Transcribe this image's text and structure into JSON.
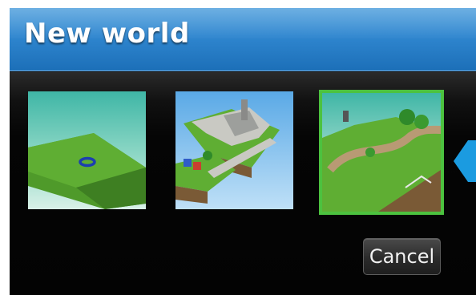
{
  "window": {
    "title": "New world"
  },
  "templates": [
    {
      "name": "flat-plain-world-thumbnail",
      "selected": false
    },
    {
      "name": "island-town-world-thumbnail",
      "selected": false
    },
    {
      "name": "hilly-path-world-thumbnail",
      "selected": true
    }
  ],
  "buttons": {
    "cancel_label": "Cancel"
  },
  "colors": {
    "title_bar": "#2f86cf",
    "background": "#060606",
    "selection_border": "#4cc23f",
    "callout_pointer": "#1b9be0"
  }
}
